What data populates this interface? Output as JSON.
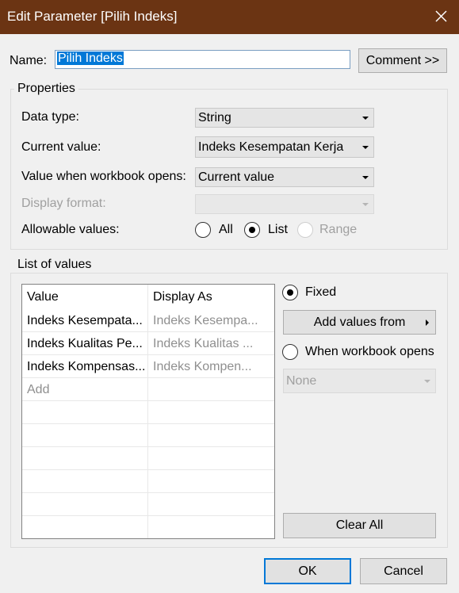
{
  "window": {
    "title": "Edit Parameter [Pilih Indeks]"
  },
  "name": {
    "label": "Name:",
    "value": "Pilih Indeks",
    "comment_button": "Comment >>"
  },
  "properties": {
    "group_label": "Properties",
    "data_type": {
      "label": "Data type:",
      "value": "String"
    },
    "current_value": {
      "label": "Current value:",
      "value": "Indeks Kesempatan Kerja"
    },
    "workbook_opens": {
      "label": "Value when workbook opens:",
      "value": "Current value"
    },
    "display_format": {
      "label": "Display format:",
      "value": ""
    },
    "allowable_values": {
      "label": "Allowable values:",
      "options": [
        "All",
        "List",
        "Range"
      ],
      "selected": "List"
    }
  },
  "list_of_values": {
    "group_label": "List of values",
    "columns": [
      "Value",
      "Display As"
    ],
    "rows": [
      {
        "value": "Indeks Kesempata...",
        "display": "Indeks Kesempa..."
      },
      {
        "value": "Indeks Kualitas Pe...",
        "display": "Indeks Kualitas ..."
      },
      {
        "value": "Indeks Kompensas...",
        "display": "Indeks Kompen..."
      }
    ],
    "add_placeholder": "Add",
    "fixed_label": "Fixed",
    "add_values_button": "Add values from",
    "workbook_opens_label": "When workbook opens",
    "workbook_opens_select": "None",
    "clear_all_button": "Clear All"
  },
  "footer": {
    "ok": "OK",
    "cancel": "Cancel"
  },
  "colors": {
    "titlebar": "#6b3413",
    "accent": "#0078d7"
  }
}
